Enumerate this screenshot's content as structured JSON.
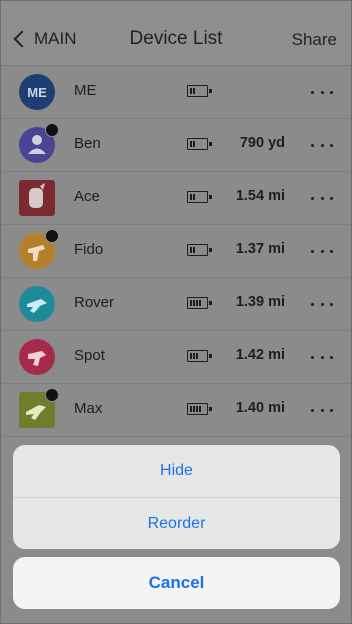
{
  "header": {
    "back_label": "MAIN",
    "title": "Device List",
    "share_label": "Share"
  },
  "devices": [
    {
      "name": "ME",
      "initials": "ME",
      "distance": "",
      "battery_bars": 2,
      "avatar_color": "#1e3f73",
      "icon": "initials",
      "badge": false
    },
    {
      "name": "Ben",
      "distance": "790 yd",
      "battery_bars": 2,
      "avatar_color": "#4b4494",
      "icon": "person-icon",
      "badge": true
    },
    {
      "name": "Ace",
      "distance": "1.54 mi",
      "battery_bars": 2,
      "avatar_color": "#7a2a30",
      "icon": "dog-photo-icon",
      "badge": false
    },
    {
      "name": "Fido",
      "distance": "1.37 mi",
      "battery_bars": 2,
      "avatar_color": "#b67f29",
      "icon": "dog-icon",
      "badge": true
    },
    {
      "name": "Rover",
      "distance": "1.39 mi",
      "battery_bars": 4,
      "avatar_color": "#1f8a99",
      "icon": "dog-icon",
      "badge": false
    },
    {
      "name": "Spot",
      "distance": "1.42 mi",
      "battery_bars": 3,
      "avatar_color": "#a62b4a",
      "icon": "dog-icon",
      "badge": false
    },
    {
      "name": "Max",
      "distance": "1.40 mi",
      "battery_bars": 4,
      "avatar_color": "#6f7d2c",
      "icon": "dog-icon",
      "badge": true
    }
  ],
  "action_sheet": {
    "hide_label": "Hide",
    "reorder_label": "Reorder",
    "cancel_label": "Cancel",
    "accent_color": "#1a73e8"
  }
}
